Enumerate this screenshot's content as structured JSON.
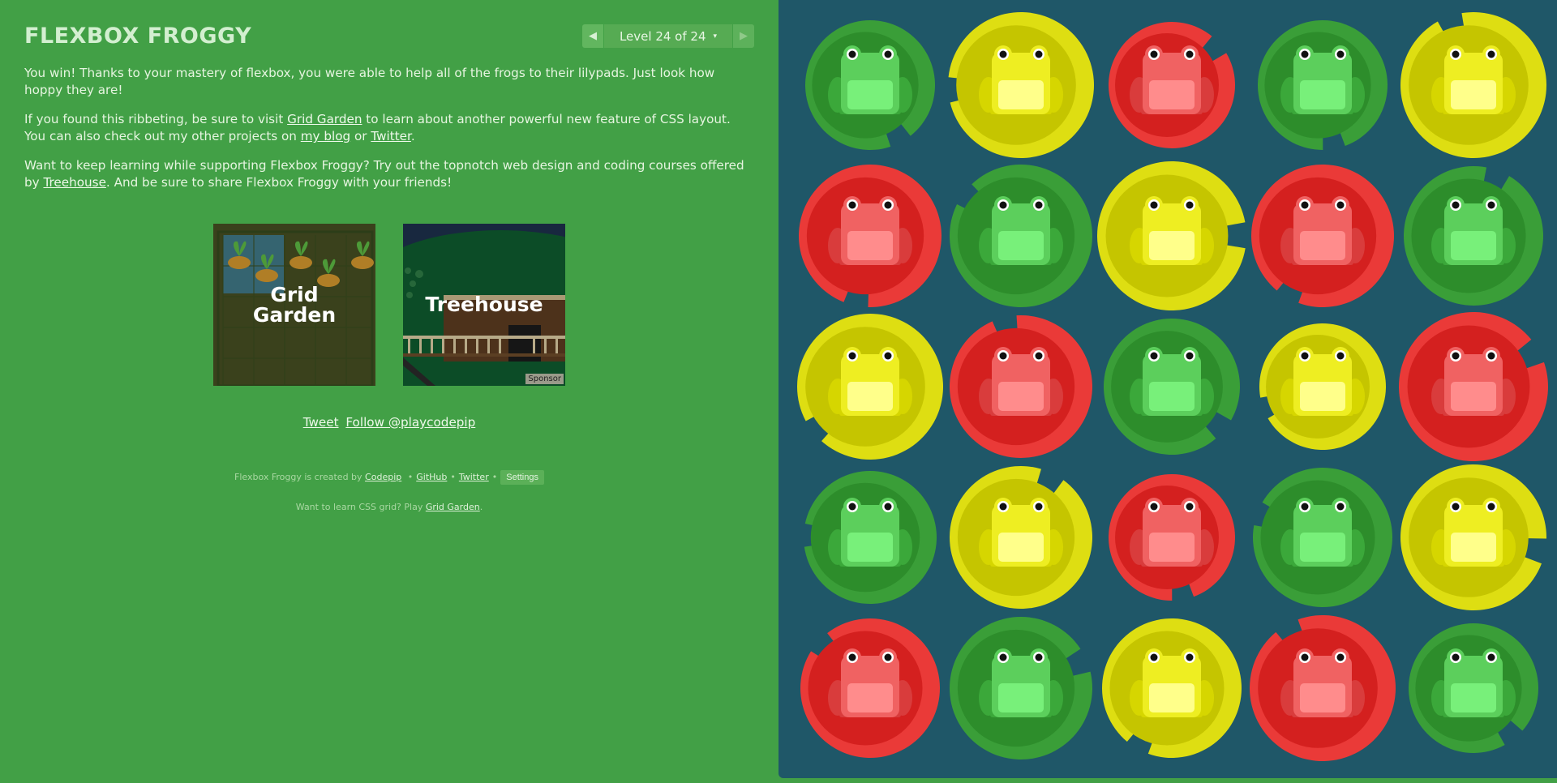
{
  "app": {
    "title": "FLEXBOX FROGGY"
  },
  "level_nav": {
    "prev_icon": "◀",
    "label": "Level 24 of 24",
    "caret": "▾",
    "next_icon": "▶"
  },
  "instructions": {
    "p1": "You win! Thanks to your mastery of flexbox, you were able to help all of the frogs to their lilypads. Just look how hoppy they are!",
    "p2_before": "If you found this ribbeting, be sure to visit ",
    "p2_link1": "Grid Garden",
    "p2_mid": " to learn about another powerful new feature of CSS layout. You can also check out my other projects on ",
    "p2_link2": "my blog",
    "p2_or": " or ",
    "p2_link3": "Twitter",
    "p2_end": ".",
    "p3_before": "Want to keep learning while supporting Flexbox Froggy? Try out the topnotch web design and coding courses offered by ",
    "p3_link": "Treehouse",
    "p3_after": ". And be sure to share Flexbox Froggy with your friends!"
  },
  "promos": {
    "grid_garden": {
      "line1": "Grid",
      "line2": "Garden"
    },
    "treehouse": {
      "label": "Treehouse",
      "sponsor": "Sponsor"
    }
  },
  "social": {
    "tweet": "Tweet",
    "follow": "Follow @playcodepip"
  },
  "footer": {
    "created_by": "Flexbox Froggy is created by",
    "codepip": "Codepip",
    "sep": "•",
    "github": "GitHub",
    "twitter": "Twitter",
    "settings": "Settings",
    "grid_prompt": "Want to learn CSS grid? Play",
    "grid_link": "Grid Garden",
    "grid_end": "."
  },
  "colors": {
    "background": "#42a046",
    "board": "#1f5768",
    "green_pad": "#2d8d2b",
    "yellow_pad": "#c5c500",
    "red_pad": "#d4201f"
  },
  "board": {
    "rows": [
      [
        "green",
        "yellow",
        "red",
        "green",
        "yellow"
      ],
      [
        "red",
        "green",
        "yellow",
        "red",
        "green"
      ],
      [
        "yellow",
        "red",
        "green",
        "yellow",
        "red"
      ],
      [
        "green",
        "yellow",
        "red",
        "green",
        "yellow"
      ],
      [
        "red",
        "green",
        "yellow",
        "red",
        "green"
      ]
    ]
  }
}
